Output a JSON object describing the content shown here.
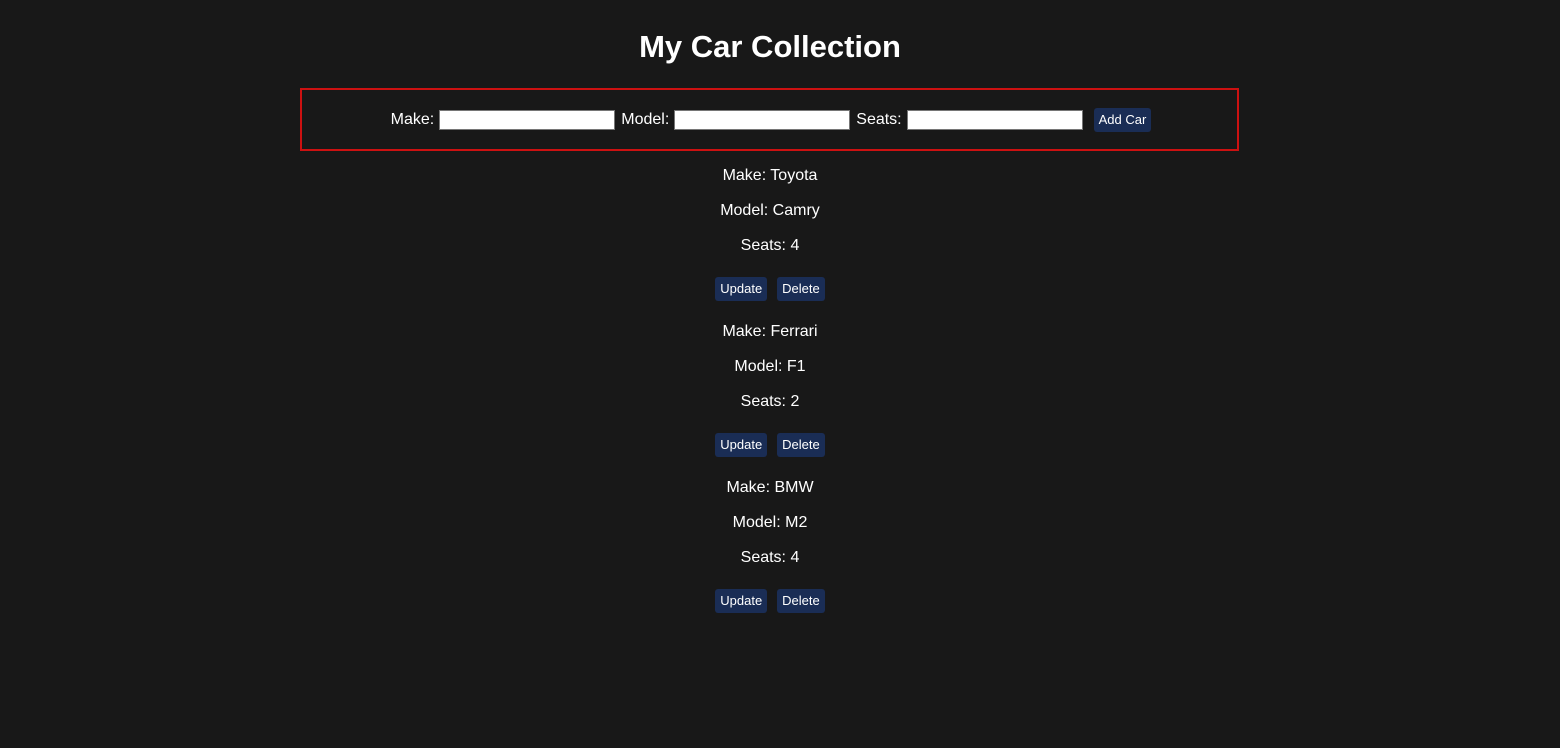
{
  "page": {
    "title": "My Car Collection"
  },
  "form": {
    "make_label": "Make:",
    "model_label": "Model:",
    "seats_label": "Seats:",
    "make_value": "",
    "model_value": "",
    "seats_value": "",
    "add_button_label": "Add Car"
  },
  "cars": [
    {
      "make": "Make: Toyota",
      "model": "Model: Camry",
      "seats": "Seats: 4",
      "update_label": "Update",
      "delete_label": "Delete"
    },
    {
      "make": "Make: Ferrari",
      "model": "Model: F1",
      "seats": "Seats: 2",
      "update_label": "Update",
      "delete_label": "Delete"
    },
    {
      "make": "Make: BMW",
      "model": "Model: M2",
      "seats": "Seats: 4",
      "update_label": "Update",
      "delete_label": "Delete"
    }
  ],
  "colors": {
    "background": "#181818",
    "form_border": "#cc1111",
    "button_bg": "#1a2d55",
    "text": "#ffffff"
  }
}
